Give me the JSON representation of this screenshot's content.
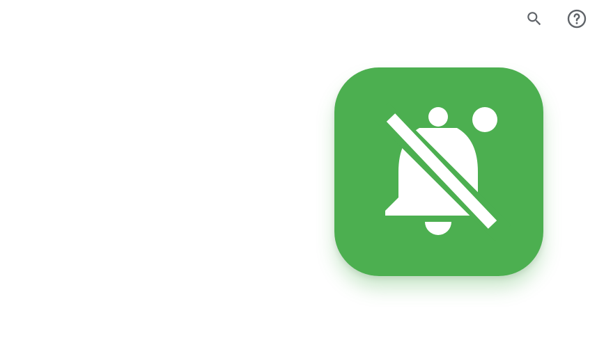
{
  "toolbar": {
    "search_icon": "search-icon",
    "help_icon": "help-circle-icon",
    "icon_color": "#5f6368"
  },
  "app_icon": {
    "glyph": "notifications-off-with-dot-icon",
    "background_color": "#4caf50",
    "glyph_color": "#ffffff"
  }
}
